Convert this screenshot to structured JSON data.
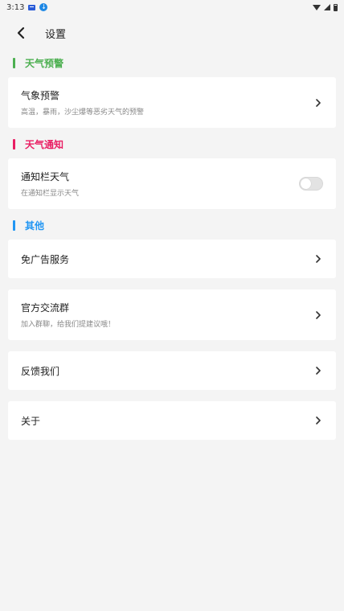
{
  "status_bar": {
    "time": "3:13"
  },
  "header": {
    "title": "设置"
  },
  "colors": {
    "weather_alert": "#4caf50",
    "weather_notify": "#e91e63",
    "other": "#2196f3"
  },
  "sections": {
    "alert": {
      "title": "天气预警",
      "items": [
        {
          "title": "气象预警",
          "subtitle": "高温，暴雨，沙尘爆等恶劣天气的预警"
        }
      ]
    },
    "notify": {
      "title": "天气通知",
      "items": [
        {
          "title": "通知栏天气",
          "subtitle": "在通知栏显示天气",
          "toggle_on": false
        }
      ]
    },
    "other": {
      "title": "其他",
      "items": [
        {
          "title": "免广告服务"
        },
        {
          "title": "官方交流群",
          "subtitle": "加入群聊，给我们提建议哦！"
        },
        {
          "title": "反馈我们"
        },
        {
          "title": "关于"
        }
      ]
    }
  }
}
